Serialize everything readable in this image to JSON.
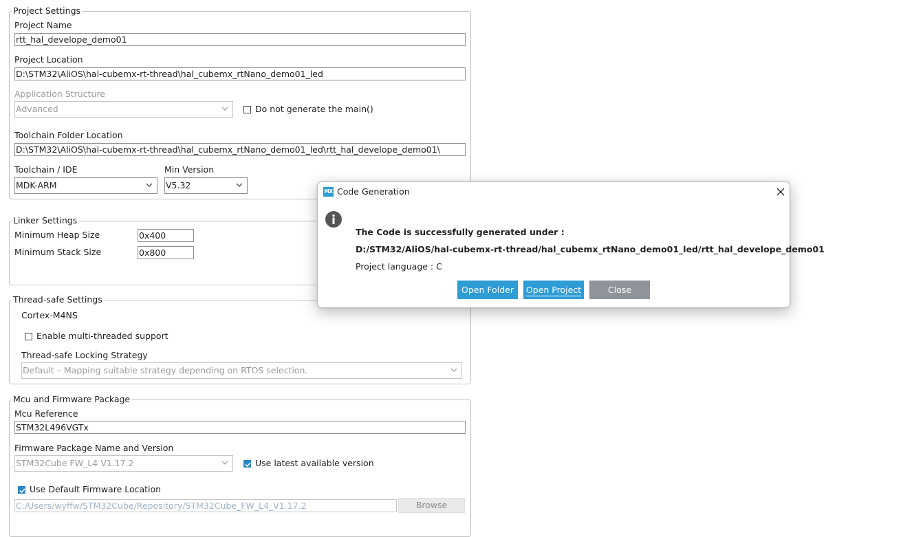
{
  "project_settings": {
    "title": "Project Settings",
    "project_name_label": "Project Name",
    "project_name_value": "rtt_hal_develope_demo01",
    "project_location_label": "Project Location",
    "project_location_value": "D:\\STM32\\AliOS\\hal-cubemx-rt-thread\\hal_cubemx_rtNano_demo01_led",
    "application_structure_label": "Application Structure",
    "application_structure_value": "Advanced",
    "do_not_generate_main_label": "Do not generate the main()",
    "do_not_generate_main_checked": false,
    "toolchain_folder_label": "Toolchain Folder Location",
    "toolchain_folder_value": "D:\\STM32\\AliOS\\hal-cubemx-rt-thread\\hal_cubemx_rtNano_demo01_led\\rtt_hal_develope_demo01\\",
    "toolchain_ide_label": "Toolchain / IDE",
    "toolchain_ide_value": "MDK-ARM",
    "min_version_label": "Min Version",
    "min_version_value": "V5.32"
  },
  "linker_settings": {
    "title": "Linker Settings",
    "min_heap_label": "Minimum Heap Size",
    "min_heap_value": "0x400",
    "min_stack_label": "Minimum Stack Size",
    "min_stack_value": "0x800"
  },
  "thread_safe": {
    "title": "Thread-safe Settings",
    "core_label": "Cortex-M4NS",
    "multithread_label": "Enable multi-threaded support",
    "multithread_checked": false,
    "locking_strategy_label": "Thread-safe Locking Strategy",
    "locking_strategy_value": "Default  –  Mapping suitable strategy depending on RTOS selection."
  },
  "mcu_firmware": {
    "title": "Mcu and Firmware Package",
    "mcu_reference_label": "Mcu Reference",
    "mcu_reference_value": "STM32L496VGTx",
    "firmware_package_label": "Firmware Package Name and Version",
    "firmware_package_value": "STM32Cube FW_L4 V1.17.2",
    "use_latest_label": "Use latest available version",
    "use_latest_checked": true,
    "use_default_location_label": "Use Default Firmware Location",
    "use_default_location_checked": true,
    "firmware_location_value": "C:/Users/wyffw/STM32Cube/Repository/STM32Cube_FW_L4_V1.17.2",
    "browse_label": "Browse"
  },
  "dialog": {
    "app_icon_text": "MX",
    "title": "Code Generation",
    "message_line1": "The Code is successfully generated under :",
    "message_path": "D:/STM32/AliOS/hal-cubemx-rt-thread/hal_cubemx_rtNano_demo01_led/rtt_hal_develope_demo01",
    "language_line": "Project language : C",
    "open_folder_label": "Open Folder",
    "open_project_label": "Open Project",
    "close_label": "Close"
  },
  "colors": {
    "button_blue": "#2e9cd5",
    "button_grey": "#8e9499",
    "checkbox_checked": "#2b86c5",
    "info_icon": "#555555"
  }
}
